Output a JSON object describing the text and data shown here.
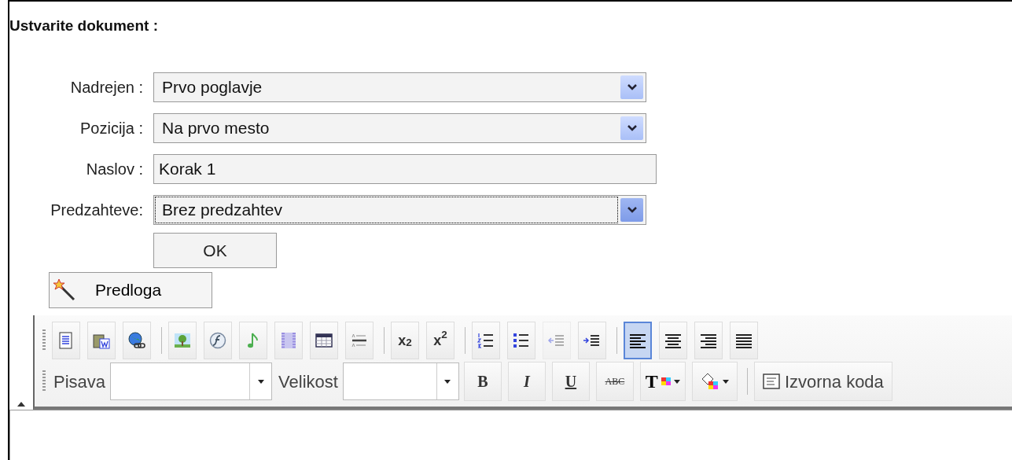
{
  "title": "Ustvarite dokument :",
  "fields": [
    {
      "kind": "select",
      "label": "Nadrejen :",
      "value": "Prvo poglavje",
      "focused": false
    },
    {
      "kind": "select",
      "label": "Pozicija :",
      "value": "Na prvo mesto",
      "focused": false
    },
    {
      "kind": "text",
      "label": "Naslov :",
      "value": "Korak 1"
    },
    {
      "kind": "select",
      "label": "Predzahteve:",
      "value": "Brez predzahtev",
      "focused": true
    }
  ],
  "ok_button": "OK",
  "template_button": "Predloga",
  "toolbar": {
    "row_1": [
      [
        {
          "kind": "document",
          "disabled": false,
          "selected": false
        },
        {
          "kind": "paste-word",
          "disabled": false,
          "selected": false
        },
        {
          "kind": "globe-link",
          "disabled": false,
          "selected": false
        }
      ],
      [
        {
          "kind": "picture",
          "disabled": false,
          "selected": false
        },
        {
          "kind": "flash",
          "disabled": false,
          "selected": false
        },
        {
          "kind": "music",
          "disabled": false,
          "selected": false
        },
        {
          "kind": "film",
          "disabled": false,
          "selected": false
        },
        {
          "kind": "table",
          "disabled": false,
          "selected": false
        },
        {
          "kind": "rule",
          "disabled": false,
          "selected": false
        }
      ],
      [
        {
          "kind": "subscript",
          "text": "x$_{2}$",
          "disabled": false,
          "selected": false
        },
        {
          "kind": "superscript",
          "text": "x$^{2}$",
          "disabled": false,
          "selected": false
        }
      ],
      [
        {
          "kind": "numbered-list",
          "disabled": false,
          "selected": false
        },
        {
          "kind": "bullet-list",
          "disabled": false,
          "selected": false
        },
        {
          "kind": "outdent",
          "disabled": true,
          "selected": false
        },
        {
          "kind": "indent",
          "disabled": false,
          "selected": false
        }
      ],
      [
        {
          "kind": "align-left",
          "disabled": false,
          "selected": true
        },
        {
          "kind": "align-center",
          "disabled": false,
          "selected": false
        },
        {
          "kind": "align-right",
          "disabled": false,
          "selected": false
        },
        {
          "kind": "justify",
          "disabled": false,
          "selected": false
        }
      ]
    ],
    "font_label": "Pisava",
    "size_label": "Velikost",
    "format_buttons": [
      {
        "kind": "bold",
        "text": "B"
      },
      {
        "kind": "italic",
        "text": "I"
      },
      {
        "kind": "underline",
        "text": "U"
      },
      {
        "kind": "strike",
        "text": "ABC"
      }
    ],
    "color_buttons": [
      {
        "kind": "text-color",
        "text": "T"
      },
      {
        "kind": "background-color"
      }
    ],
    "source_button": "Izvorna koda"
  }
}
